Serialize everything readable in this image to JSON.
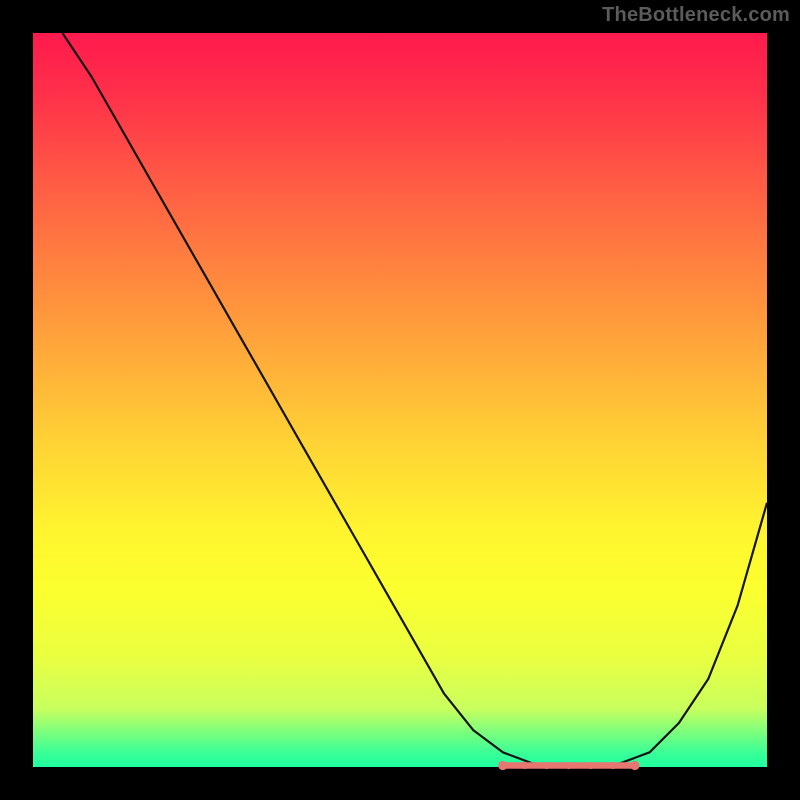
{
  "watermark": "TheBottleneck.com",
  "chart_data": {
    "type": "line",
    "title": "",
    "xlabel": "",
    "ylabel": "",
    "xlim": [
      0,
      100
    ],
    "ylim": [
      0,
      100
    ],
    "grid": false,
    "series": [
      {
        "name": "bottleneck-curve",
        "x": [
          4,
          8,
          12,
          16,
          20,
          24,
          28,
          32,
          36,
          40,
          44,
          48,
          52,
          56,
          60,
          64,
          68,
          72,
          76,
          80,
          84,
          88,
          92,
          96,
          100
        ],
        "y": [
          100,
          94,
          87,
          80,
          73,
          66,
          59,
          52,
          45,
          38,
          31,
          24,
          17,
          10,
          5,
          2,
          0.5,
          0.2,
          0.2,
          0.5,
          2,
          6,
          12,
          22,
          36
        ],
        "color": "#151515"
      }
    ],
    "annotations": [
      {
        "name": "optimal-flat-region",
        "x_start": 64,
        "x_end": 82,
        "y": 0.2,
        "color": "#e77570"
      }
    ],
    "background_gradient": {
      "top": "#ff1a4e",
      "mid": "#ffd335",
      "bottom": "#1eff9f"
    }
  }
}
